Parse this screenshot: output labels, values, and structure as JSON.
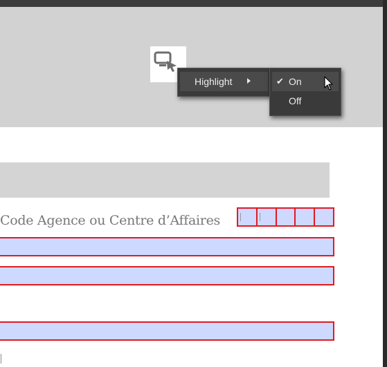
{
  "context_menu": {
    "highlight_label": "Highlight",
    "submenu": {
      "on_label": "On",
      "off_label": "Off",
      "selected": "On"
    }
  },
  "tool_button": {
    "icon": "select-object-icon"
  },
  "form": {
    "field_label": "Code Agence ou Centre d’Affaires",
    "comb_cells": 5
  },
  "colors": {
    "field_fill": "#cdd9ff",
    "field_border": "#e01a22",
    "menu_bg": "#3a3a3a"
  }
}
